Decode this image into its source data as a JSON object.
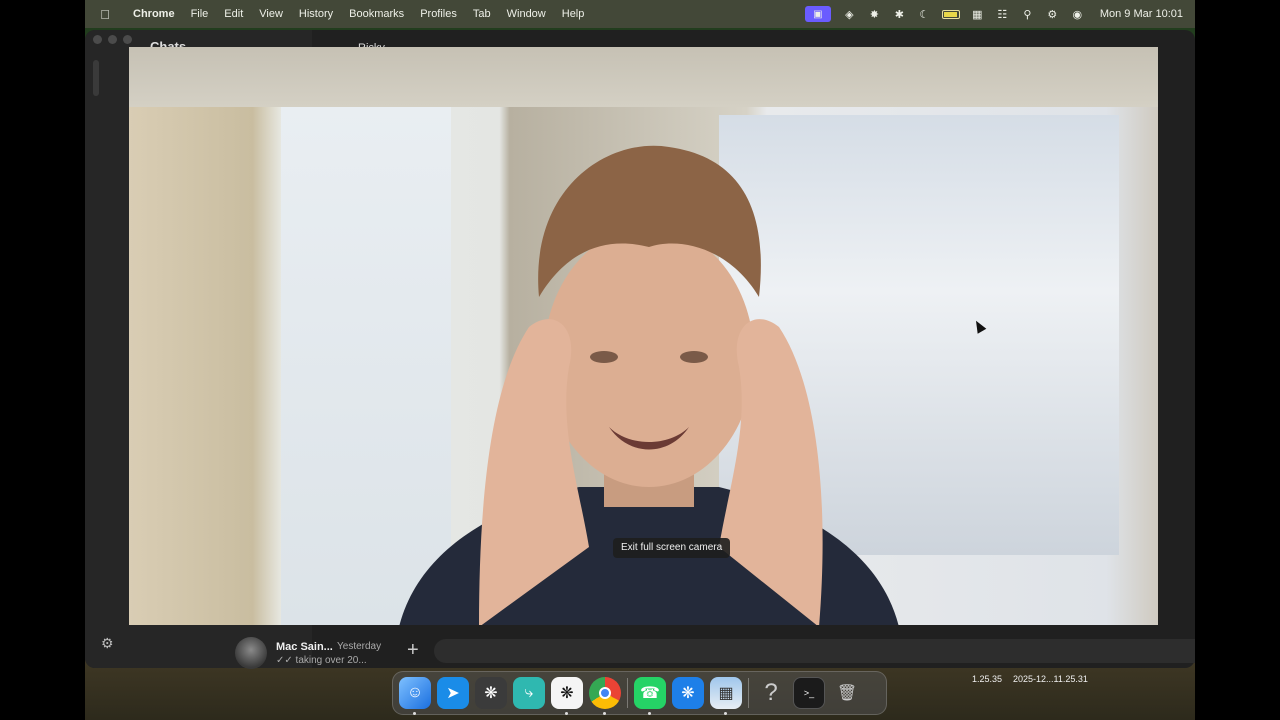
{
  "menubar": {
    "app_name": "Chrome",
    "menus": [
      "File",
      "Edit",
      "View",
      "History",
      "Bookmarks",
      "Profiles",
      "Tab",
      "Window",
      "Help"
    ],
    "clock": "Mon 9 Mar  10:01"
  },
  "whatsapp": {
    "sidebar_title": "Chats",
    "contact_name": "Ricky",
    "chat_preview": {
      "name": "Mac Sain...",
      "time": "Yesterday",
      "message": "✓✓ taking over 20..."
    }
  },
  "camera": {
    "tooltip": "Exit full screen camera"
  },
  "desktop": {
    "file_label_1": "1.25.35",
    "file_label_2": "2025-12...11.25.31"
  },
  "dock": {
    "icons": [
      "finder-icon",
      "airmail-icon",
      "chatgpt-icon",
      "setapp-icon",
      "openai-icon",
      "chrome-icon",
      "whatsapp-icon",
      "tool-icon",
      "preview-icon",
      "help-icon",
      "terminal-icon",
      "trash-icon"
    ],
    "help_glyph": "?"
  }
}
